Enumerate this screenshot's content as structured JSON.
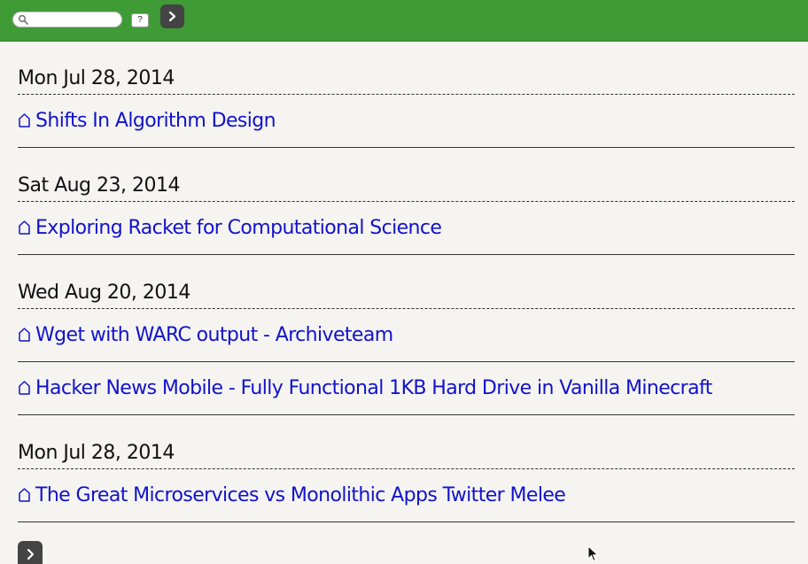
{
  "toolbar": {
    "search": {
      "placeholder": "",
      "value": ""
    },
    "help_label": "?",
    "go_icon": "chevron-right-icon",
    "accent_color": "#3e9b36"
  },
  "groups": [
    {
      "date": "Mon Jul 28, 2014",
      "entries": [
        {
          "title": "Shifts In Algorithm Design",
          "icon": "home-icon"
        }
      ]
    },
    {
      "date": "Sat Aug 23, 2014",
      "entries": [
        {
          "title": "Exploring Racket for Computational Science",
          "icon": "home-icon"
        }
      ]
    },
    {
      "date": "Wed Aug 20, 2014",
      "entries": [
        {
          "title": "Wget with WARC output - Archiveteam",
          "icon": "home-icon"
        },
        {
          "title": "Hacker News Mobile - Fully Functional 1KB Hard Drive in Vanilla Minecraft",
          "icon": "home-icon"
        }
      ]
    },
    {
      "date": "Mon Jul 28, 2014",
      "entries": [
        {
          "title": "The Great Microservices vs Monolithic Apps Twitter Melee",
          "icon": "home-icon"
        }
      ]
    }
  ],
  "pager": {
    "next_icon": "chevron-right-icon"
  },
  "colors": {
    "link": "#1212cc",
    "text": "#111111",
    "background": "#f5f4f1"
  }
}
